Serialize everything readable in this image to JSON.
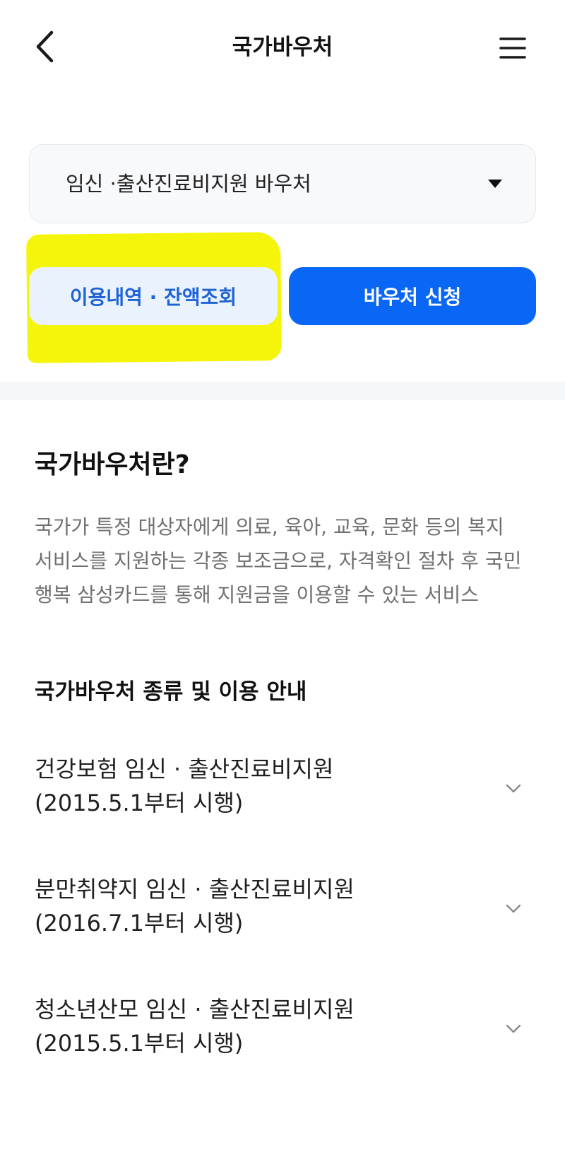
{
  "header": {
    "title": "국가바우처",
    "back_icon": "chevron-left-icon",
    "menu_icon": "hamburger-menu-icon"
  },
  "voucher_select": {
    "selected": "임신 ·출산진료비지원 바우처",
    "arrow_icon": "caret-down-icon"
  },
  "actions": {
    "usage_label": "이용내역 · 잔액조회",
    "apply_label": "바우처 신청"
  },
  "about": {
    "title": "국가바우처란?",
    "description": "국가가 특정 대상자에게 의료, 육아, 교육, 문화 등의 복지 서비스를 지원하는 각종 보조금으로, 자격확인 절차 후 국민행복 삼성카드를 통해 지원금을 이용할 수 있는 서비스"
  },
  "guide": {
    "title": "국가바우처 종류 및 이용 안내",
    "items": [
      {
        "line1": "건강보험 임신 · 출산진료비지원",
        "line2": "(2015.5.1부터 시행)"
      },
      {
        "line1": "분만취약지 임신 · 출산진료비지원",
        "line2": "(2016.7.1부터 시행)"
      },
      {
        "line1": "청소년산모 임신 · 출산진료비지원",
        "line2": "(2015.5.1부터 시행)"
      }
    ]
  },
  "colors": {
    "primary": "#0a66f5",
    "secondary_bg": "#eaf2fd",
    "secondary_text": "#1e62d6",
    "highlight": "#f5f50c"
  }
}
